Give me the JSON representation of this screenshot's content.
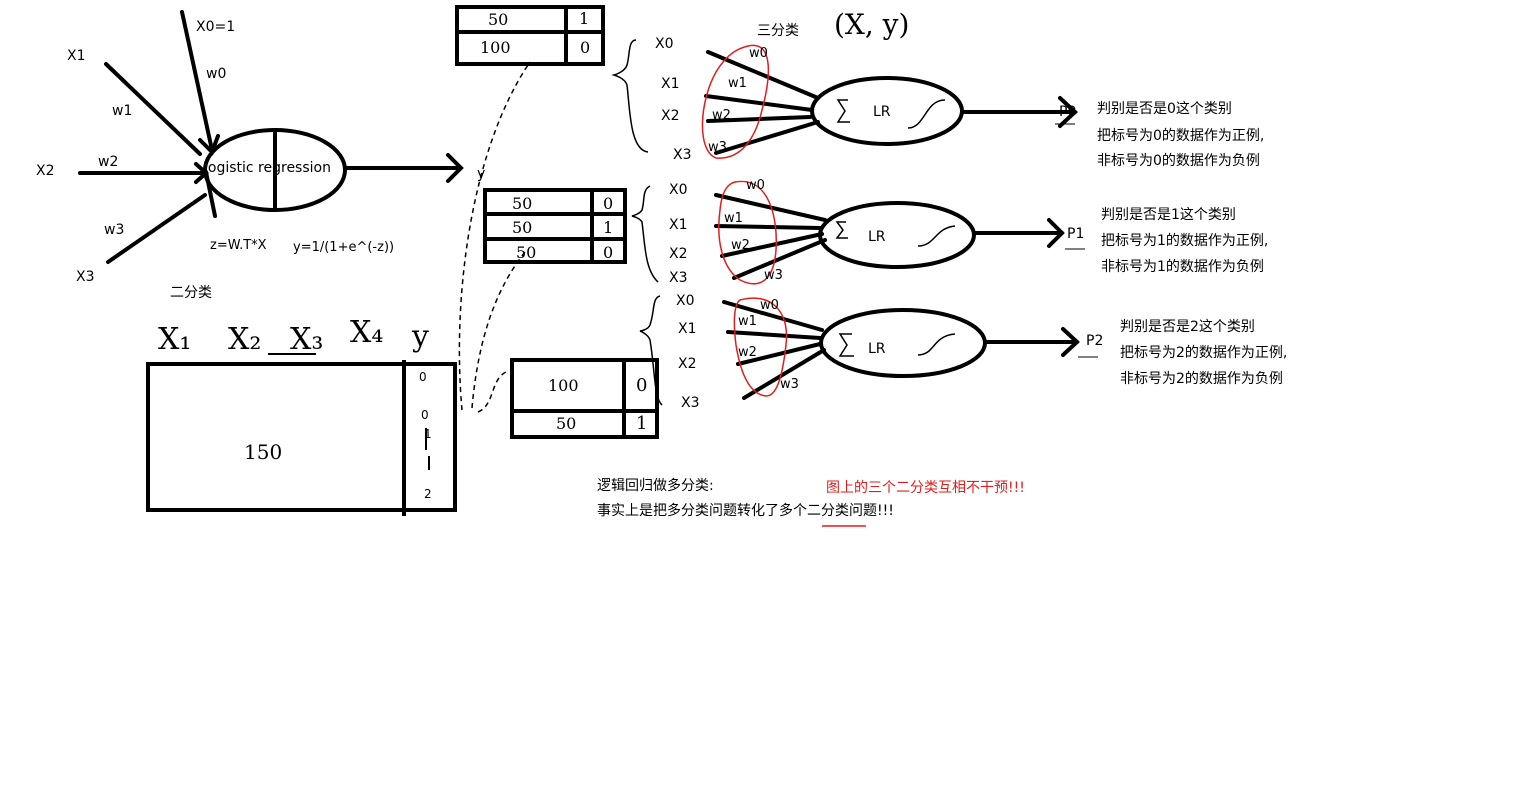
{
  "binary": {
    "x0_label": "X0=1",
    "w0_label": "w0",
    "x1_label": "X1",
    "w1_label": "w1",
    "x2_label": "X2",
    "w2_label": "w2",
    "x3_label": "X3",
    "w3_label": "w3",
    "node_label": "logistic regression",
    "output_label": "y",
    "formula_z": "z=W.T*X",
    "formula_y": "y=1/(1+e^(-z))",
    "caption": "二分类"
  },
  "dataset": {
    "columns": [
      "X₁",
      "X₂",
      "X₃",
      "X₄",
      "y"
    ],
    "rows_label": "150",
    "y_values": [
      "0",
      "0",
      "1",
      "2"
    ],
    "small_table_a": {
      "rows": [
        [
          "50",
          "1"
        ],
        [
          "100",
          "0"
        ]
      ]
    },
    "small_table_b": {
      "rows": [
        [
          "50",
          "0"
        ],
        [
          "50",
          "1"
        ],
        [
          "50",
          "0"
        ]
      ]
    },
    "small_table_c": {
      "rows": [
        [
          "100",
          "0"
        ],
        [
          "50",
          "1"
        ]
      ]
    }
  },
  "multiclass": {
    "title": "三分类",
    "xy_note": "(X, y)",
    "branches": [
      {
        "inputs": [
          "X0",
          "X1",
          "X2",
          "X3"
        ],
        "weights": [
          "w0",
          "w1",
          "w2",
          "w3"
        ],
        "node_label": "LR",
        "output": "P0",
        "notes": [
          "判别是否是0这个类别",
          "把标号为0的数据作为正例,",
          "非标号为0的数据作为负例"
        ]
      },
      {
        "inputs": [
          "X0",
          "X1",
          "X2",
          "X3"
        ],
        "weights": [
          "w0",
          "w1",
          "w2",
          "w3"
        ],
        "node_label": "LR",
        "output": "P1",
        "notes": [
          "判别是否是1这个类别",
          "把标号为1的数据作为正例,",
          "非标号为1的数据作为负例"
        ]
      },
      {
        "inputs": [
          "X0",
          "X1",
          "X2",
          "X3"
        ],
        "weights": [
          "w0",
          "w1",
          "w2",
          "w3"
        ],
        "node_label": "LR",
        "output": "P2",
        "notes": [
          "判别是否是2这个类别",
          "把标号为2的数据作为正例,",
          "非标号为2的数据作为负例"
        ]
      }
    ]
  },
  "summary": {
    "line1": "逻辑回归做多分类:",
    "line2": "事实上是把多分类问题转化了多个二分类问题!!!",
    "red_note": "图上的三个二分类互相不干预!!!",
    "accent_color": "#e11d1d"
  }
}
